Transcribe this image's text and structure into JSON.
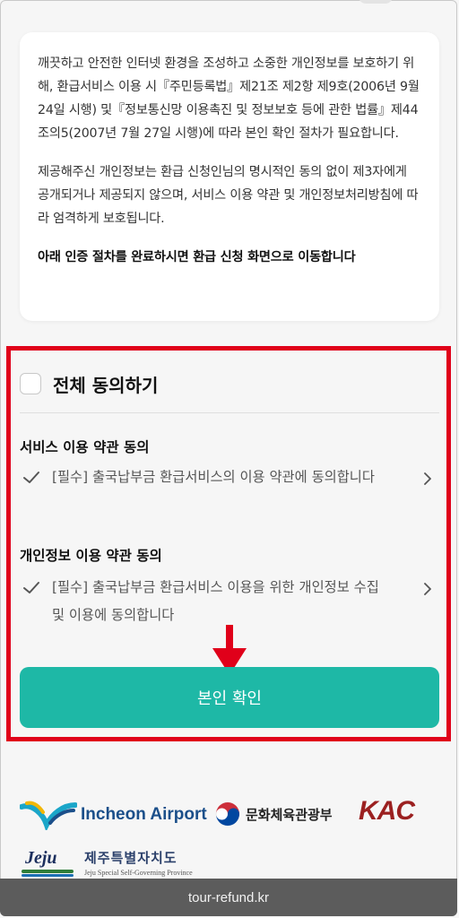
{
  "notice": {
    "paragraph1": "깨끗하고 안전한 인터넷 환경을 조성하고 소중한 개인정보를 보호하기 위해, 환급서비스 이용 시『주민등록법』제21조 제2항 제9호(2006년 9월 24일 시행) 및『정보통신망 이용촉진 및 정보보호 등에 관한 법률』제44조의5(2007년 7월 27일 시행)에 따라 본인 확인 절차가 필요합니다.",
    "paragraph2": "제공해주신 개인정보는 환급 신청인님의 명시적인 동의 없이 제3자에게 공개되거나 제공되지 않으며, 서비스 이용 약관 및 개인정보처리방침에 따라 엄격하게 보호됩니다.",
    "paragraph3": "아래 인증 절차를 완료하시면 환급 신청 화면으로 이동합니다"
  },
  "agree_all": {
    "label": "전체 동의하기",
    "checked": false
  },
  "terms": [
    {
      "title": "서비스 이용 약관 동의",
      "text": "[필수] 출국납부금 환급서비스의 이용 약관에 동의합니다",
      "checked": true
    },
    {
      "title": "개인정보 이용 약관 동의",
      "text": "[필수] 출국납부금 환급서비스 이용을 위한 개인정보 수집 및 이용에 동의합니다",
      "checked": true
    }
  ],
  "confirm_button": {
    "label": "본인 확인"
  },
  "logos": {
    "incheon": "Incheon Airport",
    "mcst": "문화체육관광부",
    "kac": "KAC",
    "jeju_mark": "Jeju",
    "jeju_kr": "제주특별자치도",
    "jeju_en": "Jeju Special Self-Governing Province"
  },
  "browser": {
    "url": "tour-refund.kr"
  },
  "colors": {
    "accent": "#1eb8a6",
    "highlight": "#e0001a",
    "arrow": "#e0001a"
  },
  "icons": [
    "check-icon",
    "chevron-right-icon",
    "down-arrow-icon"
  ]
}
